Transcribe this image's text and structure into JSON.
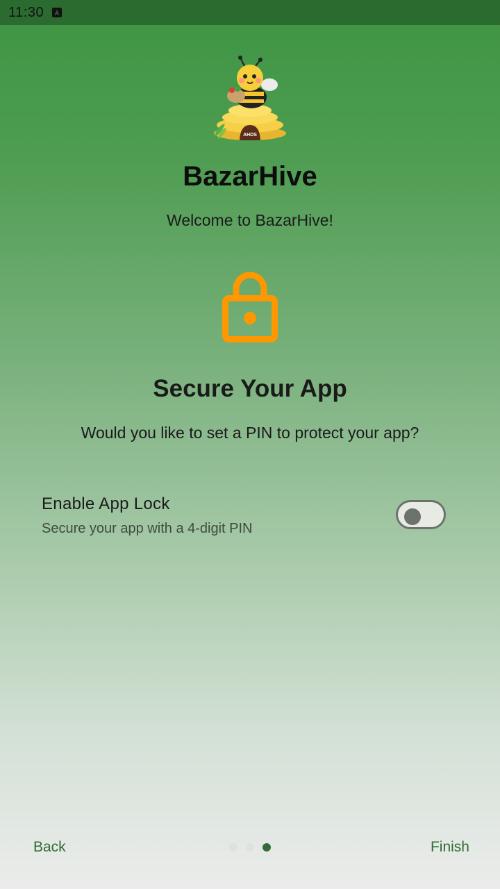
{
  "status_bar": {
    "time": "11:30",
    "notification_icon": "a-letter-icon"
  },
  "header": {
    "app_name": "BazarHive",
    "welcome": "Welcome to BazarHive!",
    "logo_badge": "AHDS"
  },
  "page": {
    "icon": "lock-icon",
    "title": "Secure Your App",
    "description": "Would you like to set a PIN to protect your app?"
  },
  "settings": {
    "app_lock": {
      "label": "Enable App Lock",
      "sublabel": "Secure your app with a 4-digit PIN",
      "enabled": false
    }
  },
  "navigation": {
    "back_label": "Back",
    "finish_label": "Finish",
    "page_count": 3,
    "current_page": 3
  },
  "colors": {
    "accent_orange": "#ff9800",
    "primary_green": "#2f6b35"
  }
}
